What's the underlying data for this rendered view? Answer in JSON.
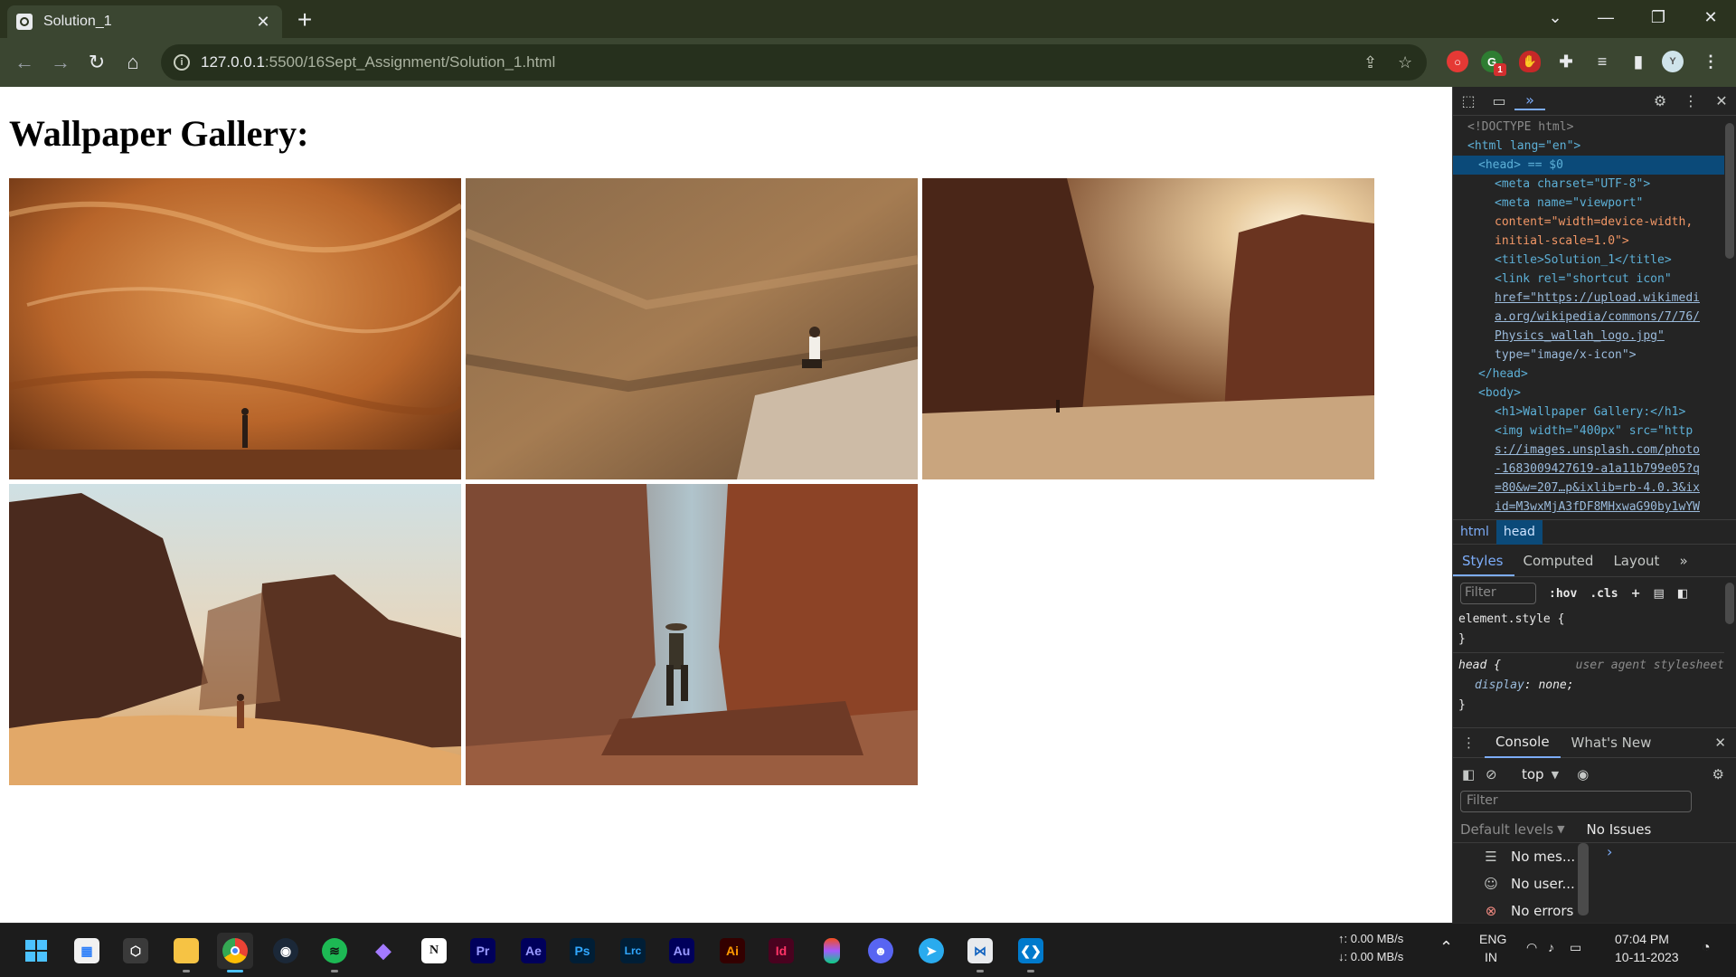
{
  "browser": {
    "tab_title": "Solution_1",
    "tab_close": "✕",
    "new_tab": "+",
    "url_host": "127.0.0.1",
    "url_rest": ":5500/16Sept_Assignment/Solution_1.html",
    "profile_initial": "Y",
    "ext_badge": "1"
  },
  "page": {
    "heading": "Wallpaper Gallery:",
    "images": [
      "canyon-cave",
      "climber-rock",
      "sunlit-canyon",
      "desert-dunes",
      "hiker-gorge"
    ]
  },
  "devtools": {
    "dom_lines": [
      {
        "text": "<!DOCTYPE html>"
      },
      {
        "text": "<html lang=\"en\">"
      },
      {
        "text": "<head> == $0"
      },
      {
        "text": "<meta charset=\"UTF-8\">"
      },
      {
        "text": "<meta name=\"viewport\""
      },
      {
        "text": "content=\"width=device-width,"
      },
      {
        "text": "initial-scale=1.0\">"
      },
      {
        "text": "<title>Solution_1</title>"
      },
      {
        "text": "<link rel=\"shortcut icon\""
      },
      {
        "text": "href=\"https://upload.wikimedi"
      },
      {
        "text": "a.org/wikipedia/commons/7/76/"
      },
      {
        "text": "Physics_wallah_logo.jpg\""
      },
      {
        "text": "type=\"image/x-icon\">"
      },
      {
        "text": "</head>"
      },
      {
        "text": "<body>"
      },
      {
        "text": "<h1>Wallpaper Gallery:</h1>"
      },
      {
        "text": "<img width=\"400px\" src=\"http"
      },
      {
        "text": "s://images.unsplash.com/photo"
      },
      {
        "text": "-1683009427619-a1a11b799e05?q"
      },
      {
        "text": "=80&w=207…p&ixlib=rb-4.0.3&ix"
      },
      {
        "text": "id=M3wxMjA3fDF8MHxwaG90by1wYW"
      }
    ],
    "breadcrumbs": [
      "html",
      "head"
    ],
    "subtabs": [
      "Styles",
      "Computed",
      "Layout"
    ],
    "filter_placeholder": "Filter",
    "hov": ":hov",
    "cls": ".cls",
    "styles": {
      "element_style": "element.style {",
      "close_brace": "}",
      "head_selector": "head {",
      "source": "user agent stylesheet",
      "prop": "display",
      "value": "none;"
    },
    "drawer_tabs": [
      "Console",
      "What's New"
    ],
    "context": "top",
    "console_filter_placeholder": "Filter",
    "default_levels": "Default levels",
    "issues": "No Issues",
    "messages": [
      "No mes...",
      "No user...",
      "No errors"
    ]
  },
  "taskbar": {
    "apps": [
      {
        "name": "start",
        "label": ""
      },
      {
        "name": "store",
        "label": ""
      },
      {
        "name": "terminal",
        "label": ""
      },
      {
        "name": "explorer",
        "label": ""
      },
      {
        "name": "chrome",
        "label": ""
      },
      {
        "name": "steam",
        "label": ""
      },
      {
        "name": "spotify",
        "label": ""
      },
      {
        "name": "obsidian",
        "label": ""
      },
      {
        "name": "notion",
        "label": "N"
      },
      {
        "name": "premiere",
        "label": "Pr"
      },
      {
        "name": "aftereffects",
        "label": "Ae"
      },
      {
        "name": "photoshop",
        "label": "Ps"
      },
      {
        "name": "lightroom",
        "label": "Lrc"
      },
      {
        "name": "audition",
        "label": "Au"
      },
      {
        "name": "illustrator",
        "label": "Ai"
      },
      {
        "name": "indesign",
        "label": "Id"
      },
      {
        "name": "figma",
        "label": ""
      },
      {
        "name": "discord",
        "label": ""
      },
      {
        "name": "telegram",
        "label": ""
      },
      {
        "name": "app-bw",
        "label": ""
      },
      {
        "name": "vscode",
        "label": ""
      }
    ],
    "net_up": "↑: 0.00 MB/s",
    "net_down": "↓: 0.00 MB/s",
    "lang": "ENG",
    "region": "IN",
    "time": "07:04 PM",
    "date": "10-11-2023"
  }
}
